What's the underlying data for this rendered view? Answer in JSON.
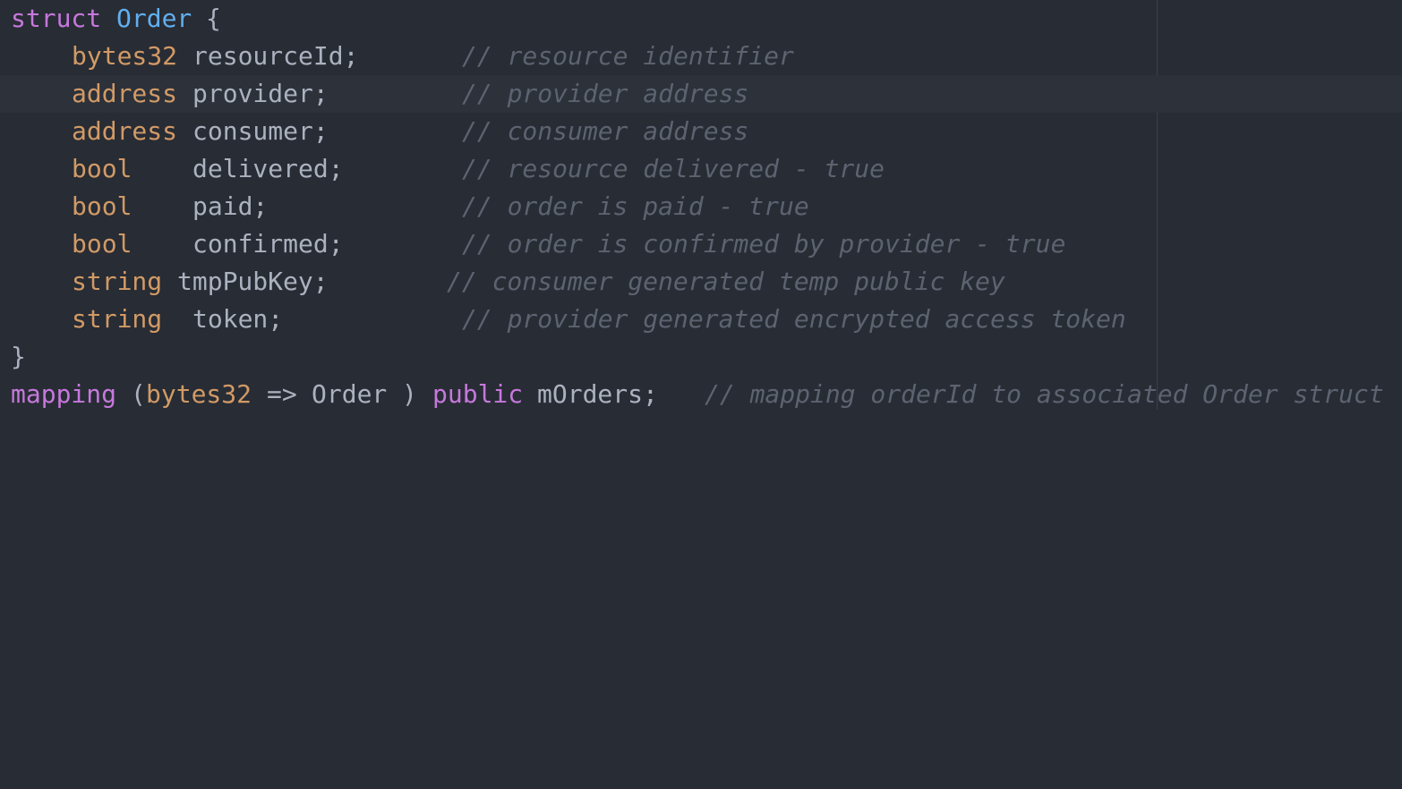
{
  "editor": {
    "lines": [
      {
        "struct_kw": "struct",
        "name": "Order",
        "brace": "{"
      },
      {
        "type": "bytes32",
        "field": "resourceId;",
        "comment": "// resource identifier"
      },
      {
        "type": "address",
        "field": "provider;",
        "comment": "// provider address"
      },
      {
        "type": "address",
        "field": "consumer;",
        "comment": "// consumer address"
      },
      {
        "type": "bool",
        "field": "delivered;",
        "comment": "// resource delivered - true"
      },
      {
        "type": "bool",
        "field": "paid;",
        "comment": "// order is paid - true"
      },
      {
        "type": "bool",
        "field": "confirmed;",
        "comment": "// order is confirmed by provider - true"
      },
      {
        "type": "string",
        "field": "tmpPubKey;",
        "comment": "// consumer generated temp public key"
      },
      {
        "type": "string",
        "field": "token;",
        "comment": "// provider generated encrypted access token"
      },
      {
        "brace": "}"
      },
      {
        "mapping_kw": "mapping",
        "open_paren": "(",
        "key_type": "bytes32",
        "arrow": "=>",
        "value_type": "Order",
        "close_paren": ")",
        "public_kw": "public",
        "var": "mOrders;",
        "comment": "// mapping orderId to associated Order struct"
      }
    ]
  }
}
